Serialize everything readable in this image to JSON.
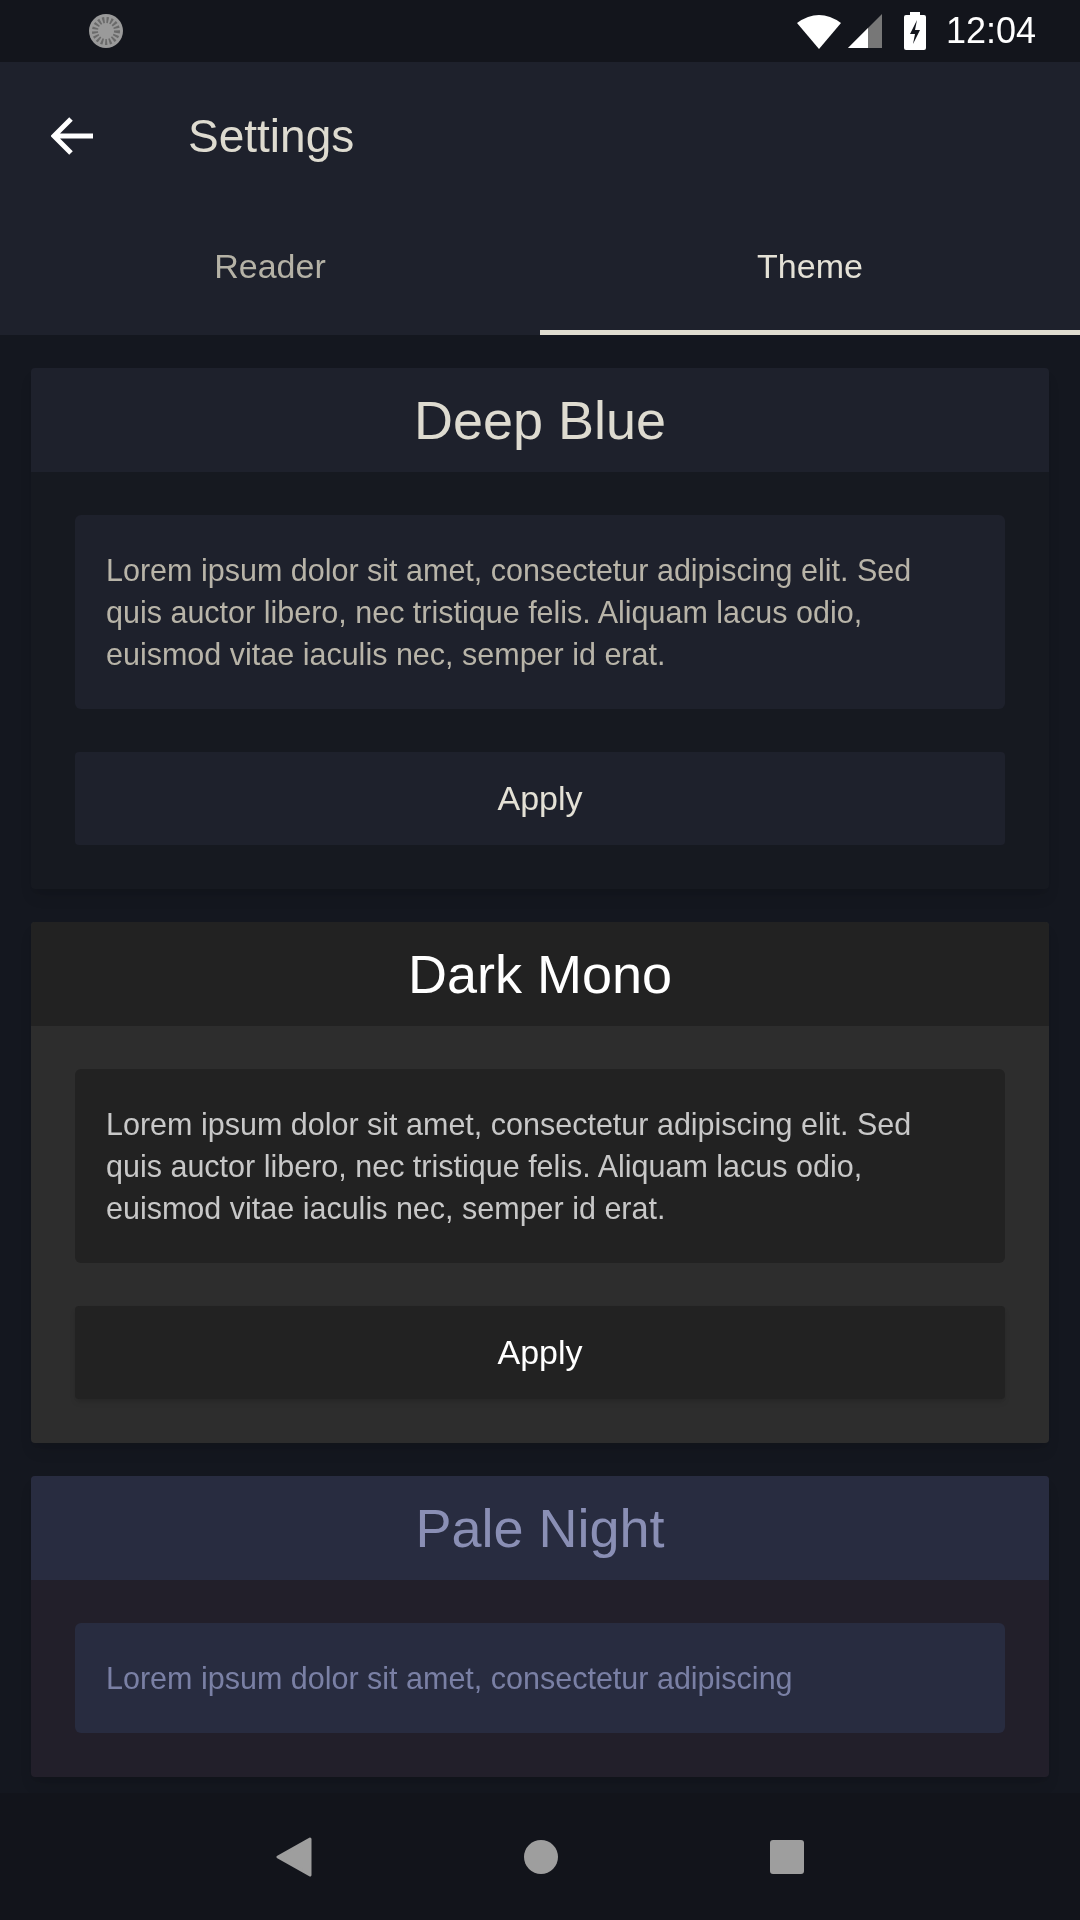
{
  "status_bar": {
    "time": "12:04"
  },
  "app_bar": {
    "title": "Settings"
  },
  "tabs": [
    {
      "label": "Reader",
      "selected": false
    },
    {
      "label": "Theme",
      "selected": true
    }
  ],
  "themes": [
    {
      "kind": "deep_blue",
      "name": "Deep Blue",
      "description": "Lorem ipsum dolor sit amet, consectetur adipiscing elit. Sed quis auctor libero, nec tristique felis. Aliquam lacus odio, euismod vitae iaculis nec, semper id erat.",
      "button": "Apply"
    },
    {
      "kind": "dark_mono",
      "name": "Dark Mono",
      "description": "Lorem ipsum dolor sit amet, consectetur adipiscing elit. Sed quis auctor libero, nec tristique felis. Aliquam lacus odio, euismod vitae iaculis nec, semper id erat.",
      "button": "Apply"
    },
    {
      "kind": "pale_night",
      "name": "Pale Night",
      "description": "Lorem ipsum dolor sit amet, consectetur adipiscing"
    }
  ]
}
